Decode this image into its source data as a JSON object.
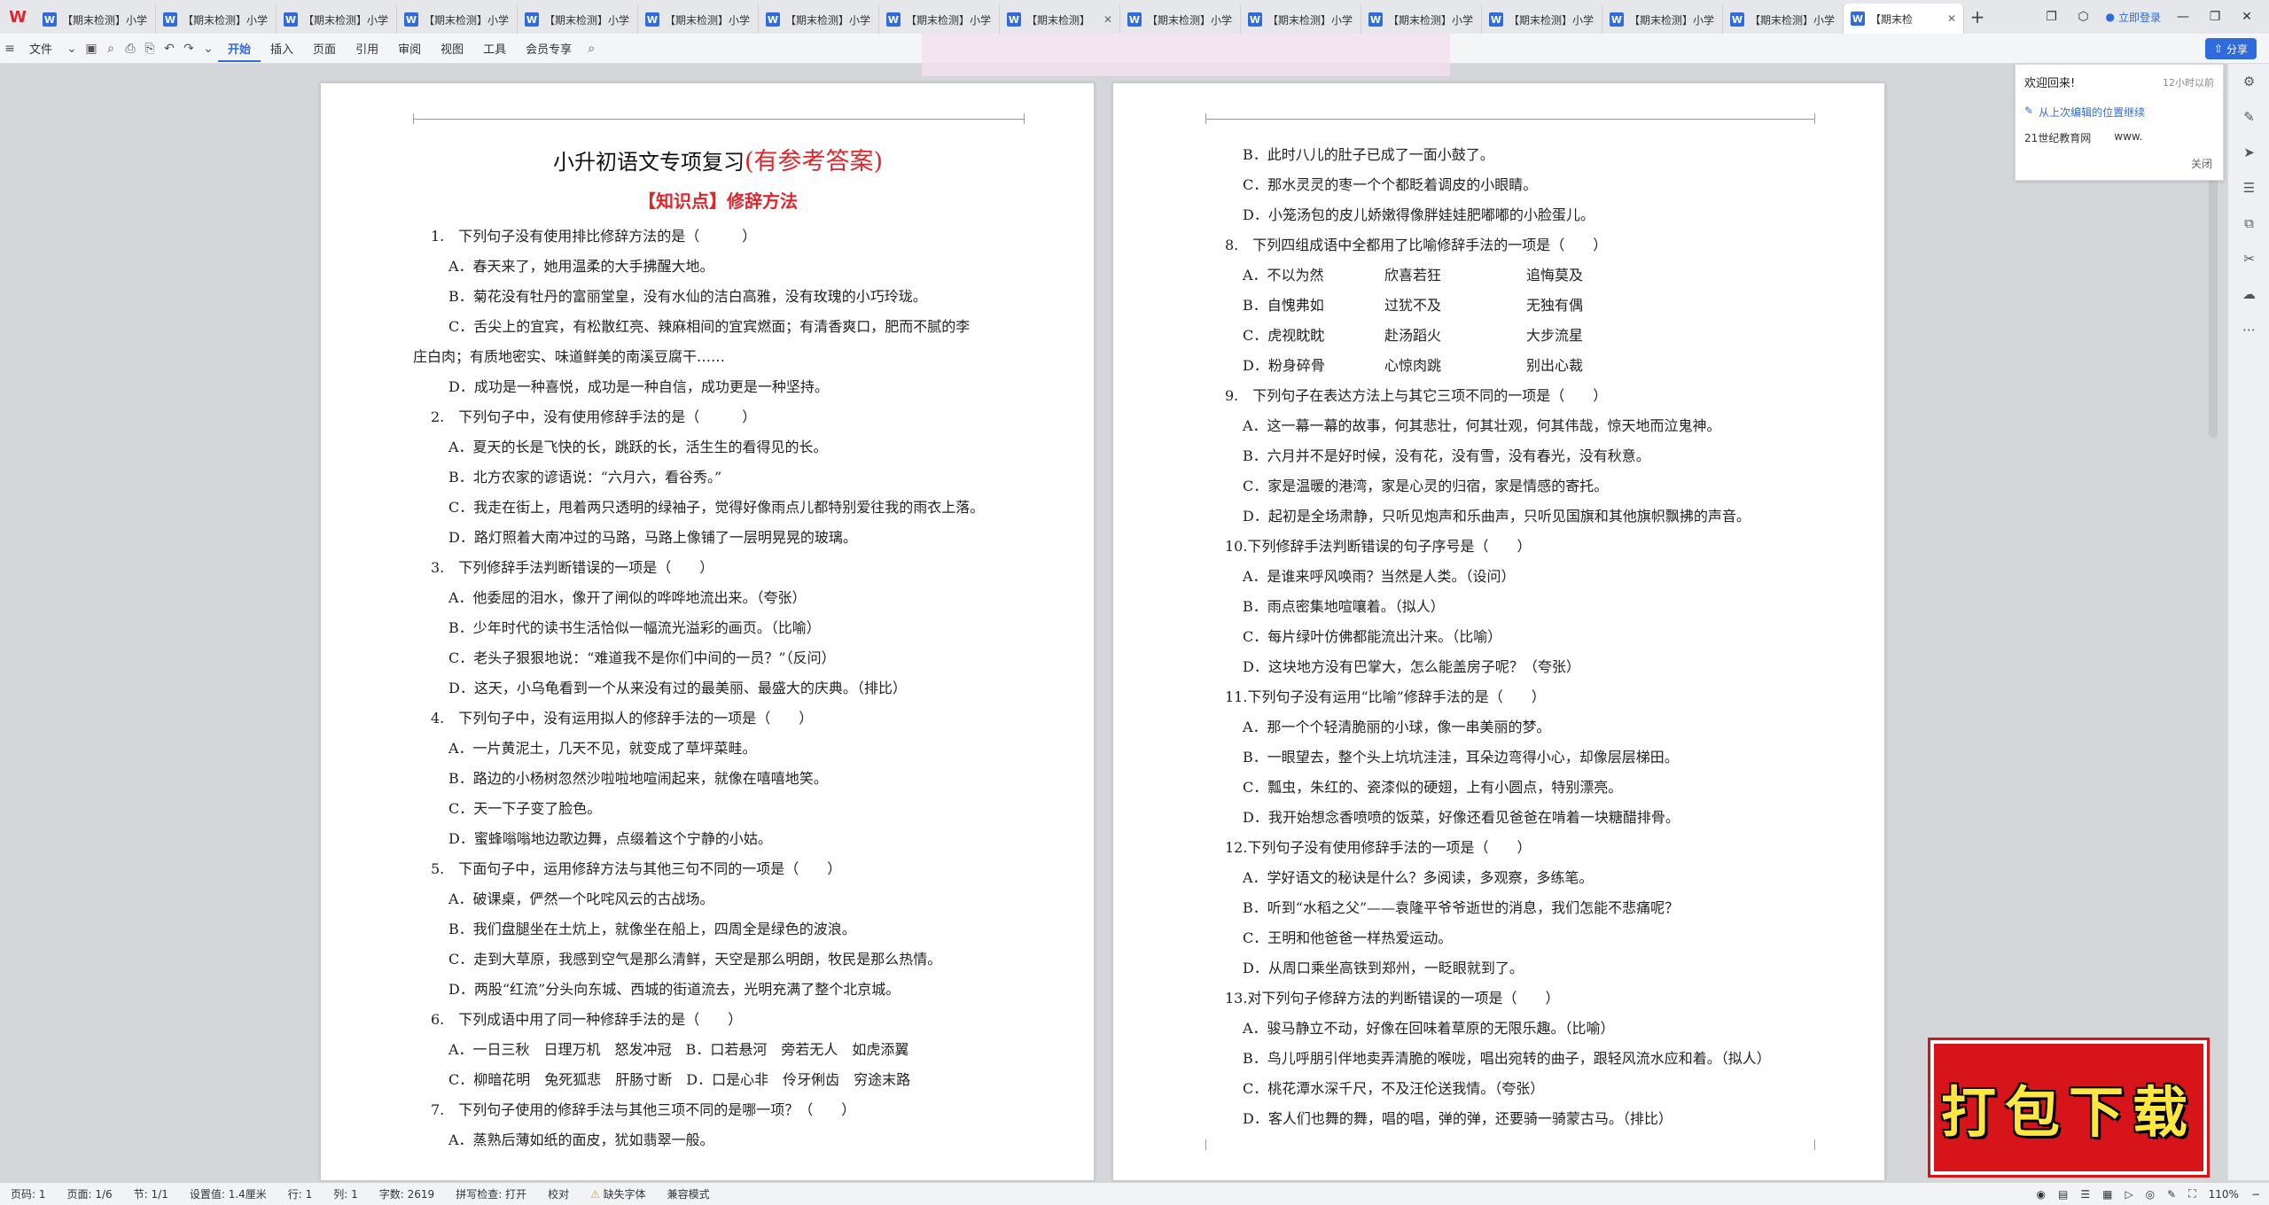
{
  "app": {
    "logo": "W"
  },
  "tabs": [
    {
      "label": "【期末检测】小学"
    },
    {
      "label": "【期末检测】小学"
    },
    {
      "label": "【期末检测】小学"
    },
    {
      "label": "【期末检测】小学"
    },
    {
      "label": "【期末检测】小学"
    },
    {
      "label": "【期末检测】小学"
    },
    {
      "label": "【期末检测】小学"
    },
    {
      "label": "【期末检测】小学"
    },
    {
      "label": "【期末检测】"
    },
    {
      "label": "【期末检测】小学"
    },
    {
      "label": "【期末检测】小学"
    },
    {
      "label": "【期末检测】小学"
    },
    {
      "label": "【期末检测】小学"
    },
    {
      "label": "【期末检测】小学"
    },
    {
      "label": "【期末检测】小学"
    },
    {
      "label": "【期末检"
    }
  ],
  "header_right": {
    "login": "立即登录"
  },
  "toolbar": {
    "file": "文件",
    "menus": [
      "开始",
      "插入",
      "页面",
      "引用",
      "审阅",
      "视图",
      "工具",
      "会员专享"
    ],
    "share": "分享"
  },
  "welcome": {
    "title": "欢迎回来!",
    "ago": "12小时以前",
    "resume": "从上次编辑的位置继续",
    "site1": "21世纪教育网",
    "site2": "www.",
    "close": "关闭"
  },
  "page1": {
    "title": "小升初语文专项复习",
    "title_red": "(有参考答案)",
    "section": "【知识点】修辞方法",
    "q1": "1.　下列句子没有使用排比修辞方法的是（　　　）",
    "q1a": "A．春天来了，她用温柔的大手拂醒大地。",
    "q1b": "B．菊花没有牡丹的富丽堂皇，没有水仙的洁白高雅，没有玫瑰的小巧玲珑。",
    "q1c1": "C．舌尖上的宜宾，有松散红亮、辣麻相间的宜宾燃面；有清香爽口，肥而不腻的李",
    "q1c2": "庄白肉；有质地密实、味道鲜美的南溪豆腐干……",
    "q1d": "D．成功是一种喜悦，成功是一种自信，成功更是一种坚持。",
    "q2": "2.　下列句子中，没有使用修辞手法的是（　　　）",
    "q2a": "A．夏天的长是飞快的长，跳跃的长，活生生的看得见的长。",
    "q2b": "B．北方农家的谚语说：“六月六，看谷秀。”",
    "q2c": "C．我走在街上，甩着两只透明的绿袖子，觉得好像雨点儿都特别爱往我的雨衣上落。",
    "q2d": "D．路灯照着大南冲过的马路，马路上像铺了一层明晃晃的玻璃。",
    "q3": "3.　下列修辞手法判断错误的一项是（　　）",
    "q3a": "A．他委屈的泪水，像开了闸似的哗哗地流出来。（夸张）",
    "q3b": "B．少年时代的读书生活恰似一幅流光溢彩的画页。（比喻）",
    "q3c": "C．老头子狠狠地说：“难道我不是你们中间的一员？”（反问）",
    "q3d": "D．这天，小乌龟看到一个从来没有过的最美丽、最盛大的庆典。（排比）",
    "q4": "4.　下列句子中，没有运用拟人的修辞手法的一项是（　　）",
    "q4a": "A．一片黄泥土，几天不见，就变成了草坪菜畦。",
    "q4b": "B．路边的小杨树忽然沙啦啦地喧闹起来，就像在嘻嘻地笑。",
    "q4c": "C．天一下子变了脸色。",
    "q4d": "D．蜜蜂嗡嗡地边歌边舞，点缀着这个宁静的小姑。",
    "q5": "5.　下面句子中，运用修辞方法与其他三句不同的一项是（　　）",
    "q5a": "A．破课桌，俨然一个叱咤风云的古战场。",
    "q5b": "B．我们盘腿坐在土炕上，就像坐在船上，四周全是绿色的波浪。",
    "q5c": "C．走到大草原，我感到空气是那么清鲜，天空是那么明朗，牧民是那么热情。",
    "q5d": "D．两股“红流”分头向东城、西城的街道流去，光明充满了整个北京城。",
    "q6": "6.　下列成语中用了同一种修辞手法的是（　　）",
    "q6a": "A．一日三秋　日理万机　怒发冲冠　B．口若悬河　旁若无人　如虎添翼",
    "q6c": "C．柳暗花明　兔死狐悲　肝肠寸断　D．口是心非　伶牙俐齿　穷途末路",
    "q7": "7.　下列句子使用的修辞手法与其他三项不同的是哪一项？（　　）",
    "q7a": "A．蒸熟后薄如纸的面皮，犹如翡翠一般。"
  },
  "page2": {
    "q7b": "B．此时八儿的肚子已成了一面小鼓了。",
    "q7c": "C．那水灵灵的枣一个个都眨着调皮的小眼睛。",
    "q7d": "D．小笼汤包的皮儿娇嫩得像胖娃娃肥嘟嘟的小脸蛋儿。",
    "q8": "8.　下列四组成语中全都用了比喻修辞手法的一项是（　　）",
    "q8rows": [
      {
        "l": "A．不以为然",
        "m": "欣喜若狂",
        "r": "追悔莫及"
      },
      {
        "l": "B．自愧弗如",
        "m": "过犹不及",
        "r": "无独有偶"
      },
      {
        "l": "C．虎视眈眈",
        "m": "赴汤蹈火",
        "r": "大步流星"
      },
      {
        "l": "D．粉身碎骨",
        "m": "心惊肉跳",
        "r": "别出心裁"
      }
    ],
    "q9": "9.　下列句子在表达方法上与其它三项不同的一项是（　　）",
    "q9a": "A．这一幕一幕的故事，何其悲壮，何其壮观，何其伟哉，惊天地而泣鬼神。",
    "q9b": "B．六月并不是好时候，没有花，没有雪，没有春光，没有秋意。",
    "q9c": "C．家是温暖的港湾，家是心灵的归宿，家是情感的寄托。",
    "q9d": "D．起初是全场肃静，只听见炮声和乐曲声，只听见国旗和其他旗帜飘拂的声音。",
    "q10": "10.下列修辞手法判断错误的句子序号是（　　）",
    "q10a": "A．是谁来呼风唤雨？当然是人类。（设问）",
    "q10b": "B．雨点密集地喧嚷着。（拟人）",
    "q10c": "C．每片绿叶仿佛都能流出汁来。（比喻）",
    "q10d": "D．这块地方没有巴掌大，怎么能盖房子呢？（夸张）",
    "q11": "11.下列句子没有运用“比喻”修辞手法的是（　　）",
    "q11a": "A．那一个个轻清脆丽的小球，像一串美丽的梦。",
    "q11b": "B．一眼望去，整个头上坑坑洼洼，耳朵边弯得小心，却像层层梯田。",
    "q11c": "C．瓢虫，朱红的、瓷漆似的硬翅，上有小圆点，特别漂亮。",
    "q11d": "D．我开始想念香喷喷的饭菜，好像还看见爸爸在啃着一块糖醋排骨。",
    "q12": "12.下列句子没有使用修辞手法的一项是（　　）",
    "q12a": "A．学好语文的秘诀是什么？多阅读，多观察，多练笔。",
    "q12b": "B．听到“水稻之父”——袁隆平爷爷逝世的消息，我们怎能不悲痛呢？",
    "q12c": "C．王明和他爸爸一样热爱运动。",
    "q12d": "D．从周口乘坐高铁到郑州，一眨眼就到了。",
    "q13": "13.对下列句子修辞方法的判断错误的一项是（　　）",
    "q13a": "A．骏马静立不动，好像在回味着草原的无限乐趣。（比喻）",
    "q13b": "B．鸟儿呼朋引伴地卖弄清脆的喉咙，唱出宛转的曲子，跟轻风流水应和着。（拟人）",
    "q13c": "C．桃花潭水深千尺，不及汪伦送我情。（夸张）",
    "q13d": "D．客人们也舞的舞，唱的唱，弹的弹，还要骑一骑蒙古马。（排比）"
  },
  "banner": {
    "text": "打包下载"
  },
  "statusbar": {
    "page": "页码: 1",
    "pages": "页面: 1/6",
    "section": "节: 1/1",
    "setting": "设置值: 1.4厘米",
    "row": "行: 1",
    "col": "列: 1",
    "words": "字数: 2619",
    "spell": "拼写检查: 打开",
    "proof": "校对",
    "font_missing": "缺失字体",
    "compat": "兼容模式",
    "zoom": "110%"
  }
}
